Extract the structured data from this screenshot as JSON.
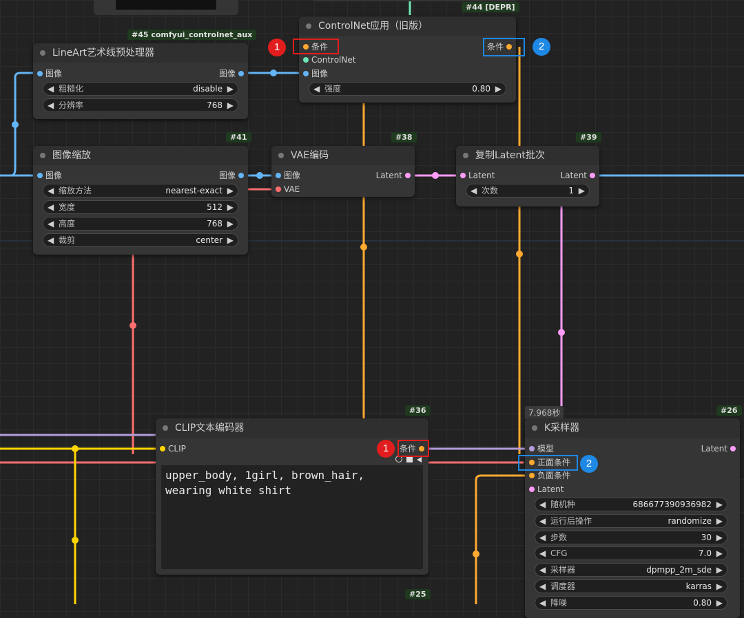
{
  "colors": {
    "image": "#64b5f6",
    "conditioning": "#ffa931",
    "controlnet": "#6ee7b7",
    "latent": "#ff9cf9",
    "vae": "#ff6e6e",
    "clip": "#ffd500",
    "model": "#b39ddb",
    "annotation_red": "#e11d1d",
    "annotation_blue": "#1e88e5"
  },
  "badges": {
    "aux": "#45 comfyui_controlnet_aux",
    "depr": "#44 [DEPR]",
    "n41": "#41",
    "n38": "#38",
    "n39": "#39",
    "n36": "#36",
    "n26": "#26",
    "n25": "#25"
  },
  "nodes": {
    "lineart": {
      "title": "LineArt艺术线预处理器",
      "in_image": "图像",
      "out_image": "图像",
      "widgets": [
        {
          "label": "粗糙化",
          "value": "disable"
        },
        {
          "label": "分辨率",
          "value": "768"
        }
      ]
    },
    "controlnet_apply": {
      "title": "ControlNet应用（旧版）",
      "in_cond": "条件",
      "in_controlnet": "ControlNet",
      "in_image": "图像",
      "out_cond": "条件",
      "widgets": [
        {
          "label": "强度",
          "value": "0.80"
        }
      ]
    },
    "image_scale": {
      "title": "图像缩放",
      "in_image": "图像",
      "out_image": "图像",
      "widgets": [
        {
          "label": "缩放方法",
          "value": "nearest-exact"
        },
        {
          "label": "宽度",
          "value": "512"
        },
        {
          "label": "高度",
          "value": "768"
        },
        {
          "label": "裁剪",
          "value": "center"
        }
      ]
    },
    "vae_encode": {
      "title": "VAE编码",
      "in_image": "图像",
      "in_vae": "VAE",
      "out_latent": "Latent"
    },
    "latent_batch": {
      "title": "复制Latent批次",
      "in_latent": "Latent",
      "out_latent": "Latent",
      "widgets": [
        {
          "label": "次数",
          "value": "1"
        }
      ]
    },
    "clip_encode": {
      "title": "CLIP文本编码器",
      "in_clip": "CLIP",
      "out_cond": "条件",
      "prompt": "upper_body, 1girl, brown_hair,\nwearing white shirt"
    },
    "ksampler": {
      "title": "K采样器",
      "timer": "7.968秒",
      "in_model": "模型",
      "in_positive": "正面条件",
      "in_negative": "负面条件",
      "in_latent": "Latent",
      "out_latent": "Latent",
      "widgets": [
        {
          "label": "随机种",
          "value": "686677390936982"
        },
        {
          "label": "运行后操作",
          "value": "randomize"
        },
        {
          "label": "步数",
          "value": "30"
        },
        {
          "label": "CFG",
          "value": "7.0"
        },
        {
          "label": "采样器",
          "value": "dpmpp_2m_sde"
        },
        {
          "label": "调度器",
          "value": "karras"
        },
        {
          "label": "降噪",
          "value": "0.80"
        }
      ]
    }
  },
  "annotations": {
    "one": "1",
    "two": "2"
  },
  "arrows": {
    "left": "◀",
    "right": "▶"
  }
}
